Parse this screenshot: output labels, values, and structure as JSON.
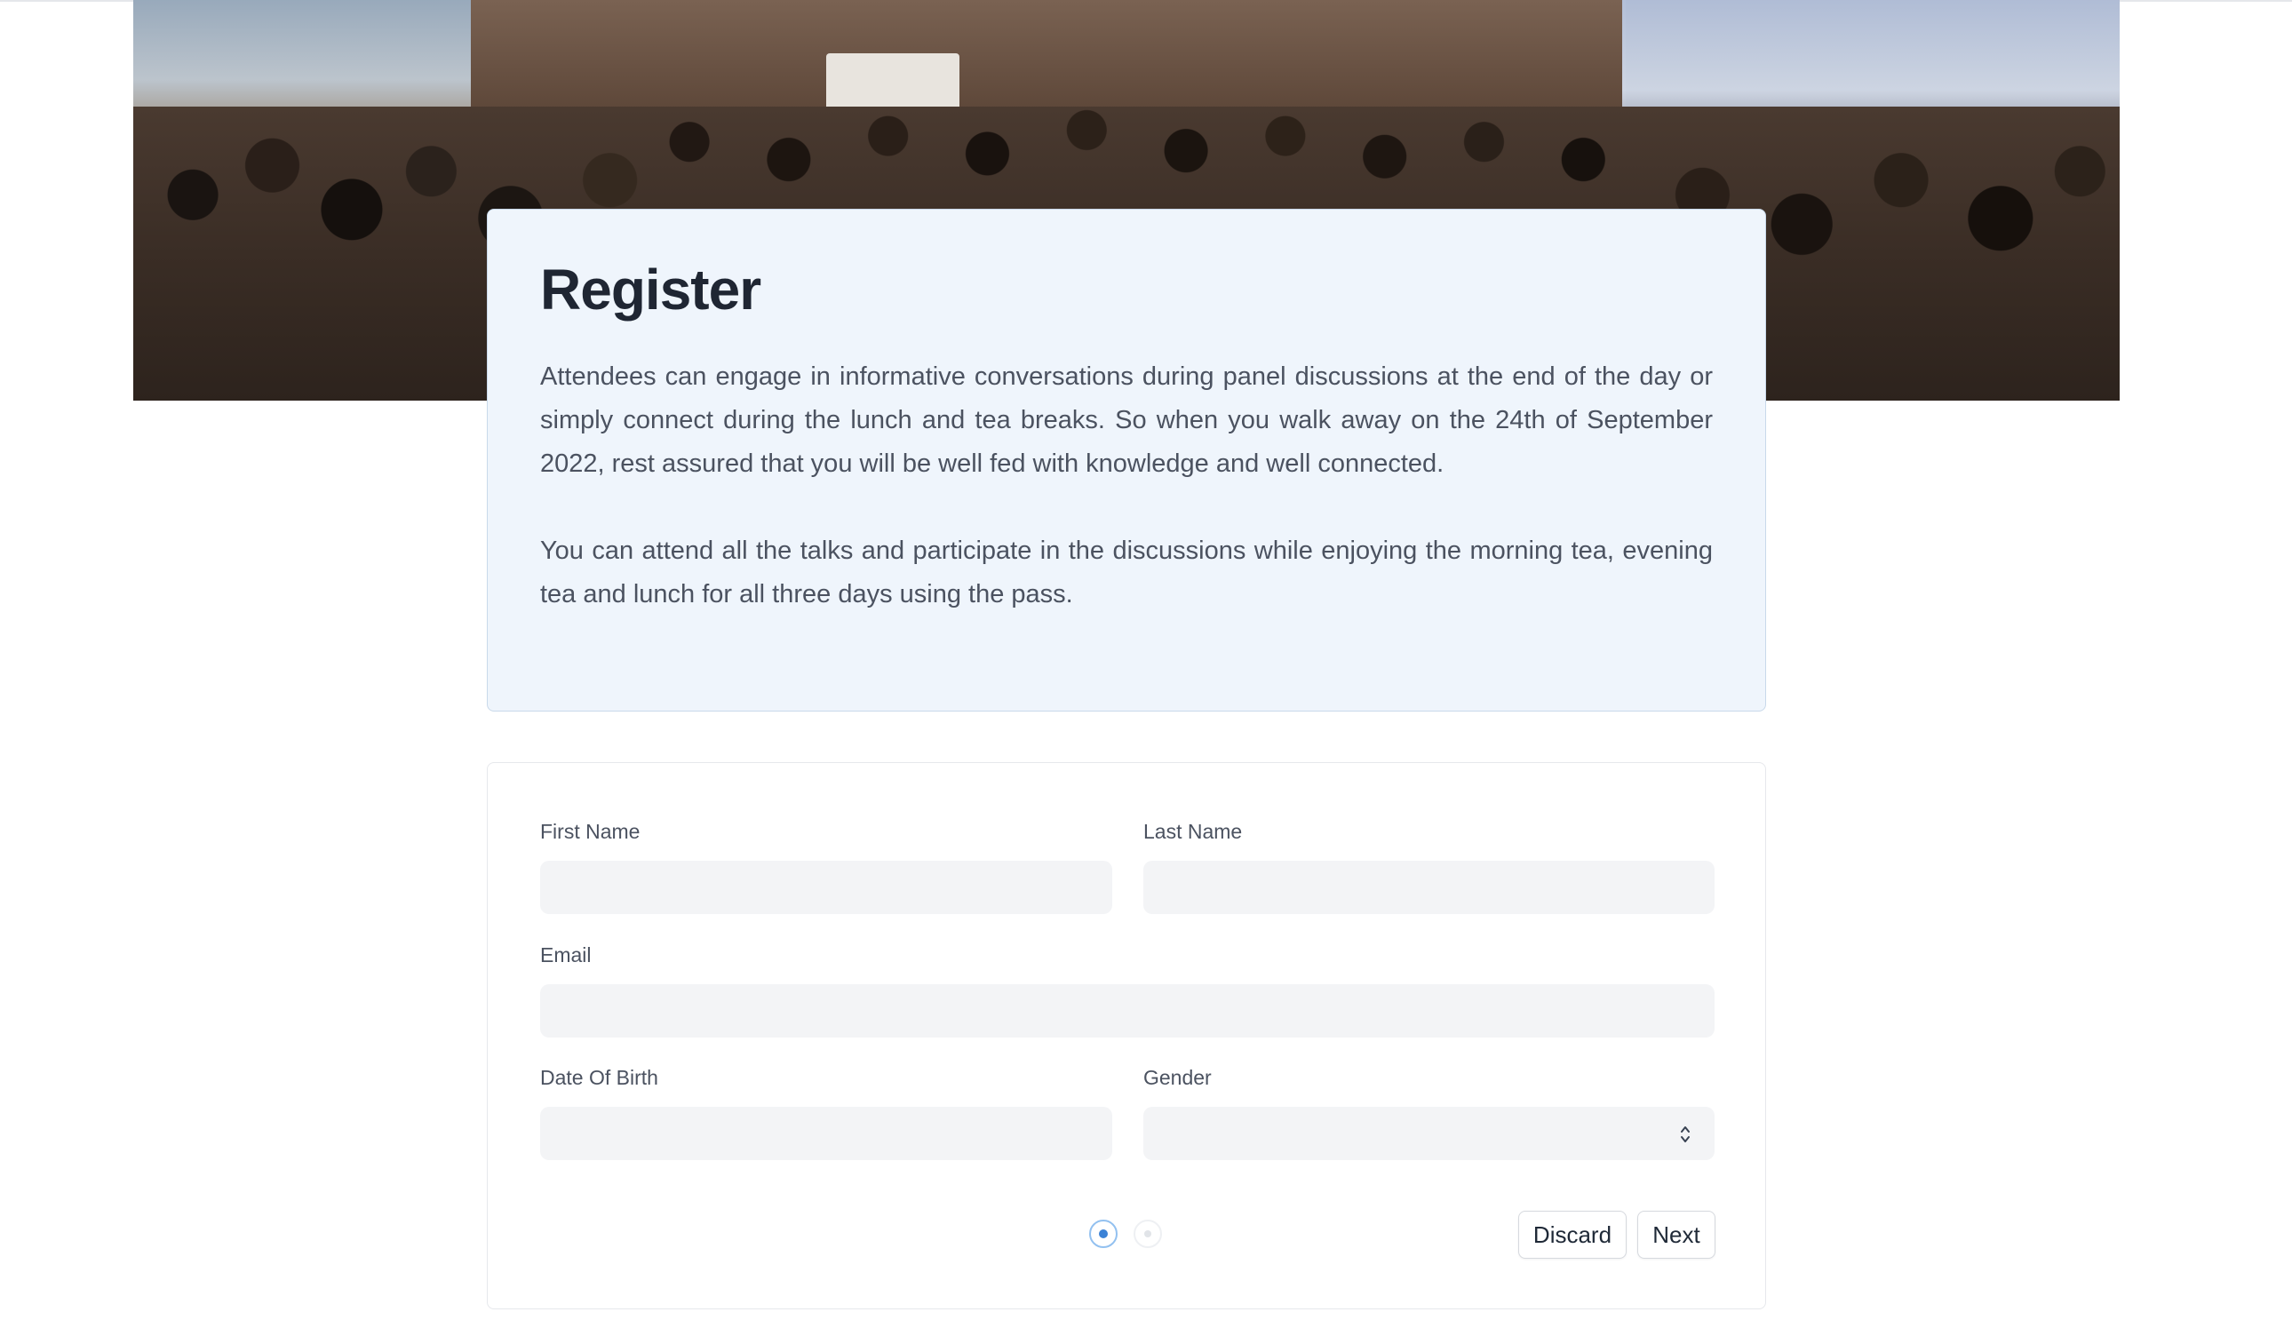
{
  "intro": {
    "title": "Register",
    "paragraphs": [
      "Attendees can engage in informative conversations during panel discussions at the end of the day or simply connect during the lunch and tea breaks. So when you walk away on the 24th of September 2022, rest assured that you will be well fed with knowledge and well connected.",
      "You can attend all the talks and participate in the discussions while enjoying the morning tea, evening tea and lunch for all three days using the pass."
    ]
  },
  "form": {
    "first_name": {
      "label": "First Name",
      "value": ""
    },
    "last_name": {
      "label": "Last Name",
      "value": ""
    },
    "email": {
      "label": "Email",
      "value": ""
    },
    "date_of_birth": {
      "label": "Date Of Birth",
      "value": ""
    },
    "gender": {
      "label": "Gender",
      "value": ""
    }
  },
  "pagination": {
    "current_step": 1,
    "total_steps": 2
  },
  "actions": {
    "discard_label": "Discard",
    "next_label": "Next"
  },
  "colors": {
    "intro_background": "#eff5fc",
    "input_background": "#f3f4f6",
    "active_step": "#3b82d6"
  }
}
